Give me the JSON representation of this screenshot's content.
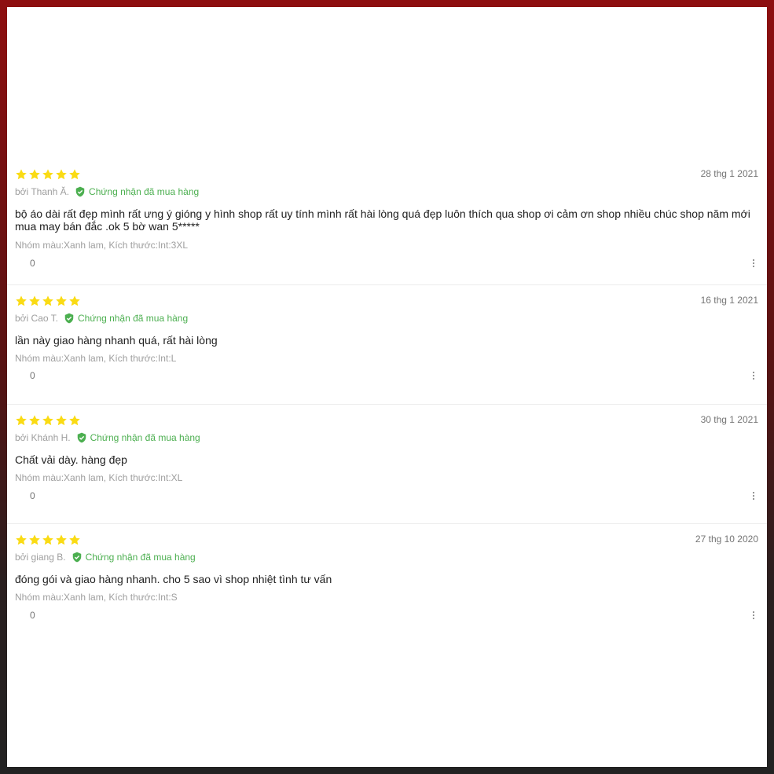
{
  "reviews": [
    {
      "rating": 5,
      "date": "28 thg 1 2021",
      "author": "bởi Thanh Ă.",
      "verified_label": "Chứng nhận đã mua hàng",
      "content": "bộ áo dài rất đẹp mình rất ưng ý gióng y hình shop rất uy tính mình rất hài lòng quá đẹp luôn thích qua shop ơi cảm ơn shop nhiều chúc shop năm  mới mua may bán đắc .ok 5 bờ wan 5*****",
      "sku": "Nhóm màu:Xanh lam, Kích thước:Int:3XL",
      "likes": "0"
    },
    {
      "rating": 5,
      "date": "16 thg 1 2021",
      "author": "bởi Cao T.",
      "verified_label": "Chứng nhận đã mua hàng",
      "content": "lần này giao hàng nhanh quá, rất hài lòng",
      "sku": "Nhóm màu:Xanh lam, Kích thước:Int:L",
      "likes": "0"
    },
    {
      "rating": 5,
      "date": "30 thg 1 2021",
      "author": "bởi Khánh H.",
      "verified_label": "Chứng nhận đã mua hàng",
      "content": "Chất vải dày. hàng đẹp",
      "sku": "Nhóm màu:Xanh lam, Kích thước:Int:XL",
      "likes": "0"
    },
    {
      "rating": 5,
      "date": "27 thg 10 2020",
      "author": "bởi giang B.",
      "verified_label": "Chứng nhận đã mua hàng",
      "content": "đóng gói và giao hàng nhanh. cho 5 sao vì shop nhiệt tình tư vấn",
      "sku": "Nhóm màu:Xanh lam, Kích thước:Int:S",
      "likes": "0"
    }
  ],
  "icons": {
    "star": "star-icon",
    "verified": "shield-check-icon",
    "menu": "more-vertical-icon"
  },
  "colors": {
    "star": "#fadb14",
    "verified": "#4caf50",
    "text": "#212121",
    "muted": "#9e9e9e"
  }
}
